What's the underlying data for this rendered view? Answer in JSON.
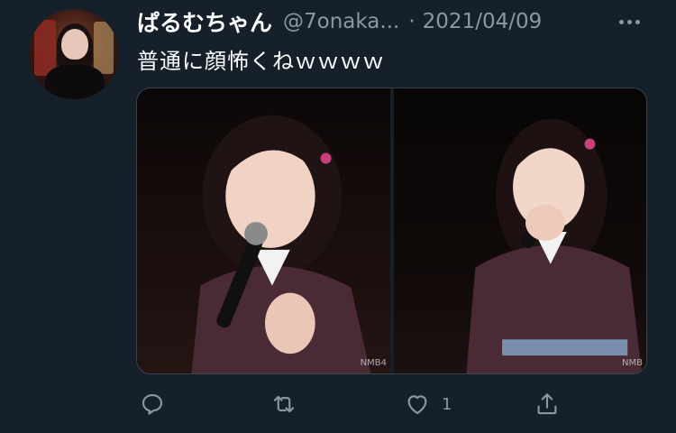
{
  "tweet": {
    "display_name": "ぱるむちゃん",
    "handle": "@7onaka...",
    "separator": "·",
    "date": "2021/04/09",
    "text": "普通に顔怖くねｗｗｗｗ",
    "media": {
      "photo_count": 2,
      "photo_1_watermark": "NMB4",
      "photo_2_watermark": "NMB"
    },
    "actions": {
      "reply": {
        "icon": "reply-icon",
        "count": ""
      },
      "retweet": {
        "icon": "retweet-icon",
        "count": ""
      },
      "like": {
        "icon": "heart-icon",
        "count": "1"
      },
      "share": {
        "icon": "share-icon",
        "count": ""
      }
    }
  },
  "colors": {
    "background": "#15202b",
    "text_primary": "#ffffff",
    "text_secondary": "#8899a6",
    "border": "#38444d"
  }
}
